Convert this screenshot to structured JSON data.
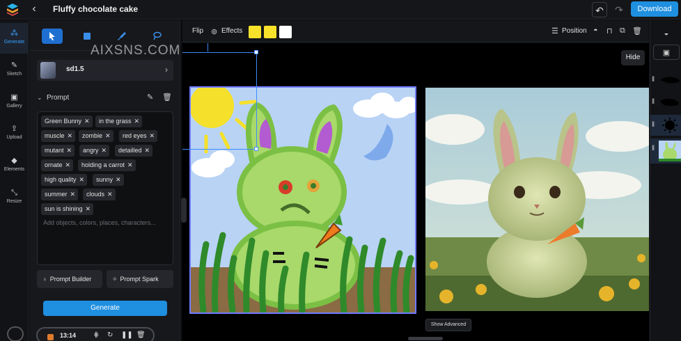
{
  "header": {
    "title": "Fluffy chocolate cake",
    "download_label": "Download"
  },
  "rail": {
    "items": [
      {
        "label": "Generate",
        "icon": "generate-icon"
      },
      {
        "label": "Sketch",
        "icon": "sketch-icon"
      },
      {
        "label": "Gallery",
        "icon": "gallery-icon"
      },
      {
        "label": "Upload",
        "icon": "upload-icon"
      },
      {
        "label": "Elements",
        "icon": "elements-icon"
      },
      {
        "label": "Resize",
        "icon": "resize-icon"
      }
    ]
  },
  "panel": {
    "model": "sd1.5",
    "prompt_label": "Prompt",
    "tags": [
      "Green Bunny",
      "in the grass",
      "muscle",
      "zombie",
      "red eyes",
      "mutant",
      "angry",
      "detailled",
      "ornate",
      "holding a carrot",
      "high quality",
      "sunny",
      "summer",
      "clouds",
      "sun is shining"
    ],
    "prompt_placeholder": "Add objects, colors, places, characters...",
    "prompt_builder_label": "Prompt Builder",
    "prompt_spark_label": "Prompt Spark",
    "generate_label": "Generate",
    "recording_time": "13:14"
  },
  "canvas_toolbar": {
    "flip_label": "Flip",
    "effects_label": "Effects",
    "position_label": "Position",
    "swatches": [
      "#f7e12a",
      "#f7e12a",
      "#ffffff"
    ]
  },
  "canvas": {
    "hide_label": "Hide",
    "show_advanced_label": "Show Advanced"
  },
  "watermark": "AIXSNS.COM",
  "colors": {
    "accent": "#1f8fe0",
    "selection": "#3d8bff"
  }
}
